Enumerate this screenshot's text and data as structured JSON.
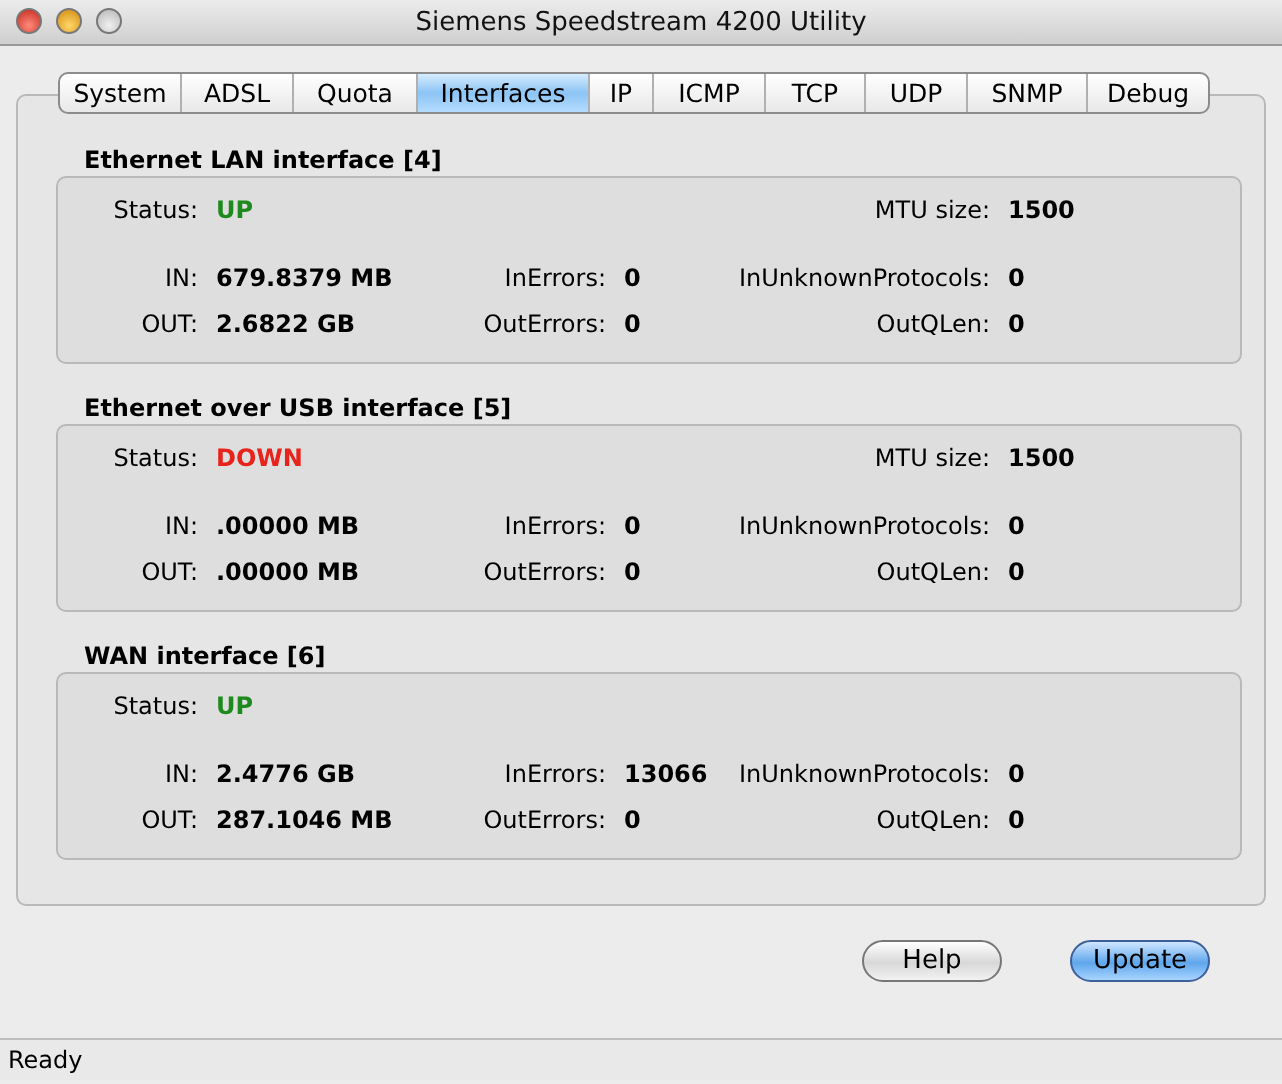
{
  "window": {
    "title": "Siemens Speedstream 4200 Utility"
  },
  "tabs": [
    {
      "label": "System",
      "selected": false
    },
    {
      "label": "ADSL",
      "selected": false
    },
    {
      "label": "Quota",
      "selected": false
    },
    {
      "label": "Interfaces",
      "selected": true
    },
    {
      "label": "IP",
      "selected": false
    },
    {
      "label": "ICMP",
      "selected": false
    },
    {
      "label": "TCP",
      "selected": false
    },
    {
      "label": "UDP",
      "selected": false
    },
    {
      "label": "SNMP",
      "selected": false
    },
    {
      "label": "Debug",
      "selected": false
    }
  ],
  "interfaces": [
    {
      "title": "Ethernet LAN interface [4]",
      "status": {
        "label": "Status:",
        "value": "UP",
        "color": "#1e8a1e"
      },
      "mtu": {
        "label": "MTU size:",
        "value": "1500"
      },
      "in": {
        "label": "IN:",
        "value": "679.8379 MB"
      },
      "out": {
        "label": "OUT:",
        "value": "2.6822 GB"
      },
      "in_errors": {
        "label": "InErrors:",
        "value": "0"
      },
      "out_errors": {
        "label": "OutErrors:",
        "value": "0"
      },
      "in_unknown_protocols": {
        "label": "InUnknownProtocols:",
        "value": "0"
      },
      "out_qlen": {
        "label": "OutQLen:",
        "value": "0"
      }
    },
    {
      "title": "Ethernet over USB interface [5]",
      "status": {
        "label": "Status:",
        "value": "DOWN",
        "color": "#e8231c"
      },
      "mtu": {
        "label": "MTU size:",
        "value": "1500"
      },
      "in": {
        "label": "IN:",
        "value": ".00000 MB"
      },
      "out": {
        "label": "OUT:",
        "value": ".00000 MB"
      },
      "in_errors": {
        "label": "InErrors:",
        "value": "0"
      },
      "out_errors": {
        "label": "OutErrors:",
        "value": "0"
      },
      "in_unknown_protocols": {
        "label": "InUnknownProtocols:",
        "value": "0"
      },
      "out_qlen": {
        "label": "OutQLen:",
        "value": "0"
      }
    },
    {
      "title": "WAN interface [6]",
      "status": {
        "label": "Status:",
        "value": "UP",
        "color": "#1e8a1e"
      },
      "in": {
        "label": "IN:",
        "value": "2.4776 GB"
      },
      "out": {
        "label": "OUT:",
        "value": "287.1046 MB"
      },
      "in_errors": {
        "label": "InErrors:",
        "value": "13066"
      },
      "out_errors": {
        "label": "OutErrors:",
        "value": "0"
      },
      "in_unknown_protocols": {
        "label": "InUnknownProtocols:",
        "value": "0"
      },
      "out_qlen": {
        "label": "OutQLen:",
        "value": "0"
      }
    }
  ],
  "buttons": [
    {
      "label": "Help",
      "kind": "normal"
    },
    {
      "label": "Update",
      "kind": "default"
    }
  ],
  "status_bar": {
    "text": "Ready"
  }
}
